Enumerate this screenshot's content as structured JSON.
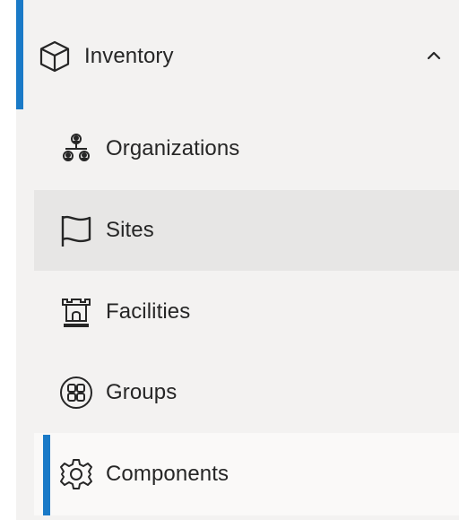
{
  "nav": {
    "section": {
      "label": "Inventory",
      "icon": "cube-icon",
      "expanded": true,
      "toggle_icon": "chevron-up-icon"
    },
    "items": [
      {
        "label": "Organizations",
        "icon": "organization-icon",
        "state": "default"
      },
      {
        "label": "Sites",
        "icon": "flag-icon",
        "state": "hover"
      },
      {
        "label": "Facilities",
        "icon": "castle-icon",
        "state": "default"
      },
      {
        "label": "Groups",
        "icon": "grid-circle-icon",
        "state": "default"
      },
      {
        "label": "Components",
        "icon": "gear-icon",
        "state": "selected"
      }
    ]
  },
  "colors": {
    "accent": "#1a7ac7",
    "panel_background": "#f3f2f1",
    "hover_background": "#e7e6e5",
    "selected_background": "#faf9f8",
    "text": "#262626"
  }
}
